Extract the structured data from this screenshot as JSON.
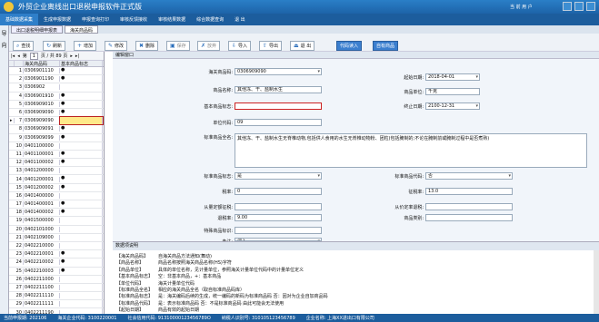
{
  "app": {
    "title": "外贸企业离线出口退税申报软件正式版",
    "user": "当 前 用 户",
    "colors": {
      "accent": "#1d63a8",
      "selected": "#ffe98a"
    }
  },
  "menu": [
    "基础数据采集",
    "生成申报数据",
    "申报查询打印",
    "审核反馈接收",
    "审核结果数据",
    "综合数据查询",
    "退 出"
  ],
  "sidebar": [
    "导",
    "向"
  ],
  "tabs": [
    "出口退税明细申报表",
    "海关商品码"
  ],
  "toolbar": {
    "query": "查找",
    "refresh": "刷新",
    "add": "增加",
    "modify": "修改",
    "delete": "删除",
    "save": "保存",
    "cancel": "放弃",
    "import": "导入",
    "export": "导出",
    "code_import": "代码读入",
    "self_code": "自有商品"
  },
  "grid": {
    "pager": {
      "page_label": "第",
      "page": "1",
      "of": "页 / 共 89 页"
    },
    "headers": [
      "海关商品码",
      "基本商品标志"
    ],
    "rows": [
      [
        "1",
        "0306901110",
        "●"
      ],
      [
        "2",
        "0306901190",
        "●"
      ],
      [
        "3",
        "0306902",
        ""
      ],
      [
        "4",
        "0306901910",
        "●"
      ],
      [
        "5",
        "0306909010",
        "●"
      ],
      [
        "6",
        "0306909090",
        "●"
      ],
      [
        "7",
        "0306909090",
        ""
      ],
      [
        "8",
        "0306909091",
        "●"
      ],
      [
        "9",
        "0306909099",
        "●"
      ],
      [
        "10",
        "0401100000",
        ""
      ],
      [
        "11",
        "0401100001",
        "●"
      ],
      [
        "12",
        "0401100002",
        "●"
      ],
      [
        "13",
        "0401200000",
        ""
      ],
      [
        "14",
        "0401200001",
        "●"
      ],
      [
        "15",
        "0401200002",
        "●"
      ],
      [
        "16",
        "0401400000",
        ""
      ],
      [
        "17",
        "0401400001",
        "●"
      ],
      [
        "18",
        "0401400002",
        "●"
      ],
      [
        "19",
        "0401500000",
        ""
      ],
      [
        "20",
        "0402101000",
        ""
      ],
      [
        "21",
        "0402109000",
        ""
      ],
      [
        "22",
        "0402210000",
        ""
      ],
      [
        "23",
        "0402210001",
        "●"
      ],
      [
        "24",
        "0402210002",
        "●"
      ],
      [
        "25",
        "0402210003",
        "●"
      ],
      [
        "26",
        "0402211000",
        ""
      ],
      [
        "27",
        "0402211100",
        ""
      ],
      [
        "28",
        "0402211110",
        ""
      ],
      [
        "29",
        "0402211111",
        ""
      ],
      [
        "30",
        "0402211190",
        ""
      ]
    ]
  },
  "panel": {
    "header": "编辑窗口",
    "labels": {
      "code": "海关商品码:",
      "name": "商品名称:",
      "basic": "基本商品标志:",
      "unit_code": "单位代码:",
      "std_name": "标准商品全名:",
      "start": "起始日期:",
      "unit": "商品单位:",
      "end": "终止日期:",
      "std_flag": "标准商品标志:",
      "tax_rate": "税率:",
      "qty_calc": "从量定额征税:",
      "refund_rate": "退税率:",
      "special": "特殊商品标识:",
      "remark": "备注:",
      "std_code": "标准商品代码:",
      "levy_rate": "征税率:",
      "qty_refund": "从价定率退税:",
      "category": "商品类别:"
    },
    "values": {
      "code": "0306909090",
      "name": "其他冻、干、盐制水生",
      "basic": "",
      "unit_code": "09",
      "std_name": "其他冻、干、盐制水生无脊椎动物,包括供人食用的水生无脊椎动物粉、团粒(包括腌制的;不论在腌制前或腌制过程中是否煮熟)",
      "start": "2018-04-01",
      "unit": "千克",
      "end": "2100-12-31",
      "std_flag": "是",
      "tax_rate": "0",
      "qty_calc": "",
      "refund_rate": "9.00",
      "special": "",
      "remark": "调入",
      "std_code": "否",
      "levy_rate": "13.0",
      "qty_refund": "",
      "category": ""
    }
  },
  "explain": {
    "header": "数据项说明",
    "rows": [
      [
        "【海关商品码】",
        "自海关商品方法通知(舞动)"
      ],
      [
        "【商品名称】",
        "商品名称按照海关商品名称(HS)字符"
      ],
      [
        "【商品单位】",
        "具体的单位名称，见计量单位，参照海关计量单位代码中的计量单位定义"
      ],
      [
        "【基本商品标志】",
        "空：非基本商品，+：基本商品"
      ],
      [
        "【单位代码】",
        "海关计量单位代码"
      ],
      [
        "【标准商品全名】",
        "相应的海关商品全名（取自标准商品码库）"
      ],
      [
        "【标准商品标志】",
        "是：海关编码后续的生成，统一编码的新码为标准商品码  否：因对为企业自加商品码"
      ],
      [
        "【标准商品代码】",
        "是：表示标准商品码  否：不是标准商品码  由此可能会无法使用"
      ],
      [
        "【起始日期】",
        "商品有效的起始日期"
      ]
    ]
  },
  "status": [
    "当前申报期: 202106",
    "海关企业代码: 3100220001",
    "社会信用代码: 91310000123456789O",
    "纳税人识别号: 310105123456789",
    "企业名称: 上海XX进出口有限公司"
  ]
}
